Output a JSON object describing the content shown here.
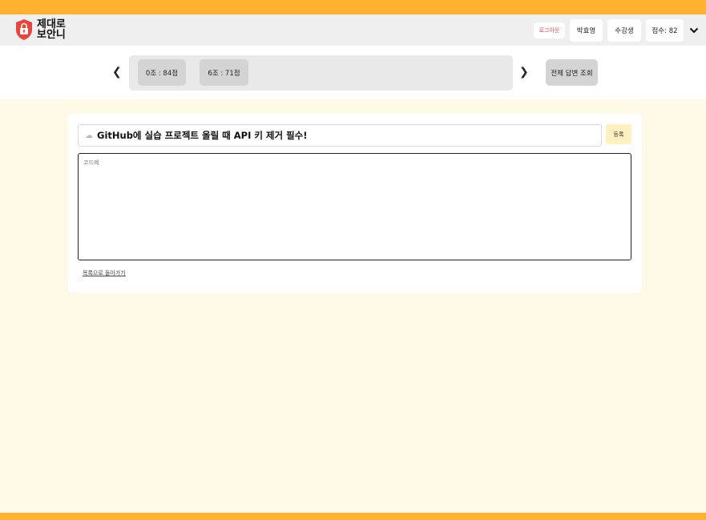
{
  "colors": {
    "accent": "#ffb12e",
    "background": "#fffae8",
    "logout": "#e04a4a"
  },
  "header": {
    "logo_line1": "제대로",
    "logo_line2": "보안니",
    "logout_label": "로그아웃",
    "user_name": "박효영",
    "role": "수강생",
    "score": "점수: 82"
  },
  "nav": {
    "prev": "❮",
    "next": "❯",
    "tabs": [
      {
        "label": "0조 : 84점"
      },
      {
        "label": "6조 : 71점"
      }
    ],
    "all_answers": "전체 답변 조회"
  },
  "post": {
    "title_icon": "cloud-icon",
    "title": "GitHub에 실습 프로젝트 올릴 때 API 키 제거 필수!",
    "register": "등록",
    "code_placeholder": "코드예",
    "back_link": "목록으로 돌아가기"
  }
}
